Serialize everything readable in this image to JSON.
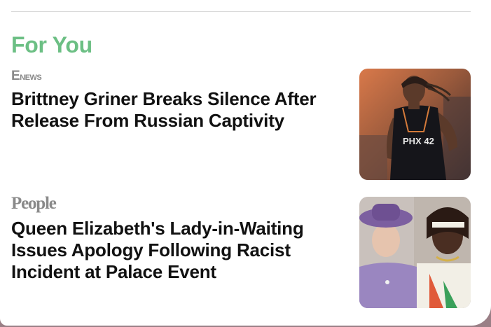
{
  "section": {
    "title": "For You"
  },
  "stories": [
    {
      "source": "E NEWS",
      "source_e": "E",
      "source_rest": "NEWS",
      "headline": "Brittney Griner Breaks Silence After Release From Russian Captivity",
      "thumbnail_alt": "",
      "thumbnail_jersey": "PHX 42"
    },
    {
      "source": "People",
      "headline": "Queen Elizabeth's Lady-in-Waiting Issues Apology Following Racist Incident at Palace Event",
      "thumbnail_alt": ""
    }
  ],
  "colors": {
    "section_title": "#6cbf84",
    "headline": "#111111",
    "source": "#8a8a8a"
  }
}
